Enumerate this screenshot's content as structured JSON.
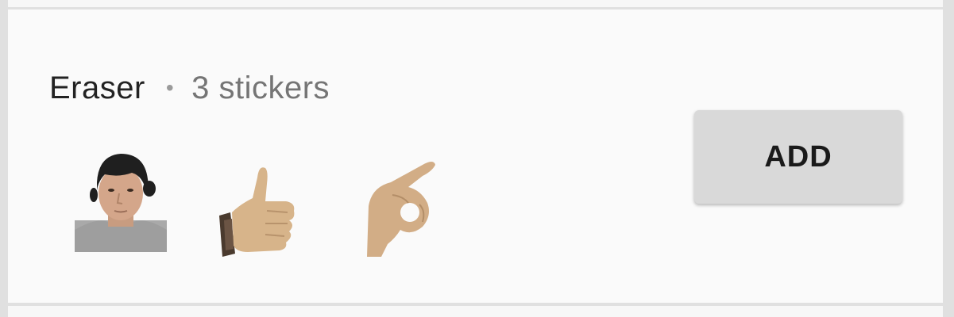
{
  "pack": {
    "name": "Eraser",
    "separator": "•",
    "count_label": "3 stickers"
  },
  "stickers": [
    {
      "icon": "person-face-sticker"
    },
    {
      "icon": "thumbs-up-sticker"
    },
    {
      "icon": "ok-hand-sticker"
    }
  ],
  "actions": {
    "add_label": "ADD"
  }
}
